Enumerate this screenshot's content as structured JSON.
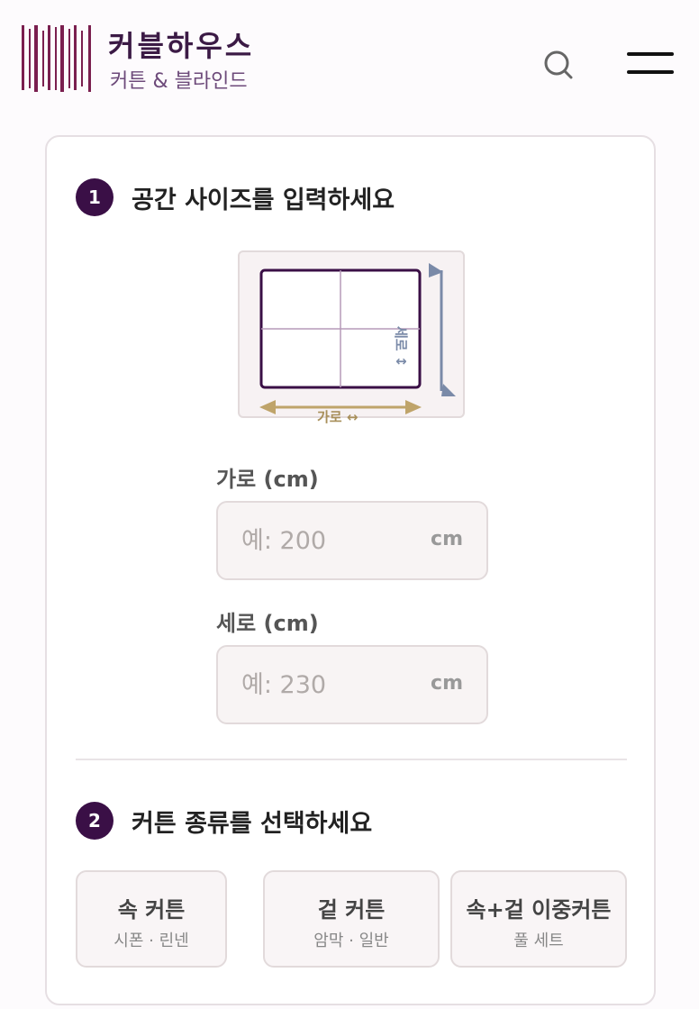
{
  "header": {
    "brand_title": "커블하우스",
    "brand_subtitle": "커튼 & 블라인드"
  },
  "icons": {
    "search": "search-icon",
    "menu": "hamburger-menu-icon"
  },
  "colors": {
    "brand": "#3a0f46",
    "width_accent": "#bfa46a",
    "height_accent": "#7a8aa8"
  },
  "step1": {
    "number": "1",
    "title": "공간 사이즈를 입력하세요",
    "diagram": {
      "width_label": "가로 ↔",
      "height_label": "세로 ↕"
    },
    "width_field": {
      "label": "가로 (cm)",
      "placeholder": "예: 200",
      "unit": "cm"
    },
    "height_field": {
      "label": "세로 (cm)",
      "placeholder": "예: 230",
      "unit": "cm"
    }
  },
  "step2": {
    "number": "2",
    "title": "커튼 종류를 선택하세요",
    "options": [
      {
        "label": "속 커튼",
        "sub": "시폰 · 린넨"
      },
      {
        "label": "겉 커튼",
        "sub": "암막 · 일반"
      },
      {
        "label": "속+겉 이중커튼",
        "sub": "풀 세트"
      }
    ]
  }
}
